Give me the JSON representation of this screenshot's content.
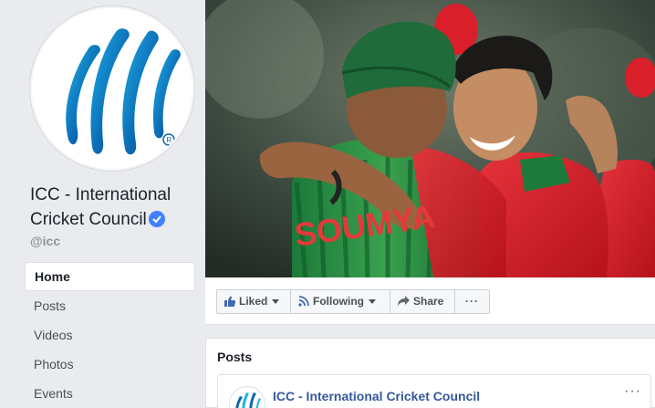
{
  "page": {
    "name": "ICC - International Cricket Council",
    "handle": "@icc",
    "verified": true,
    "logo_icon": "icc-logo-icon",
    "accent": "#4080ff",
    "link_color": "#365899"
  },
  "nav": {
    "items": [
      {
        "label": "Home",
        "active": true
      },
      {
        "label": "Posts",
        "active": false
      },
      {
        "label": "Videos",
        "active": false
      },
      {
        "label": "Photos",
        "active": false
      },
      {
        "label": "Events",
        "active": false
      }
    ]
  },
  "actions": {
    "liked_label": "Liked",
    "following_label": "Following",
    "share_label": "Share",
    "more_label": "···"
  },
  "posts": {
    "title": "Posts",
    "author": "ICC - International Cricket Council",
    "more_label": "···"
  },
  "cover": {
    "jersey_text": "SOUMYA"
  }
}
